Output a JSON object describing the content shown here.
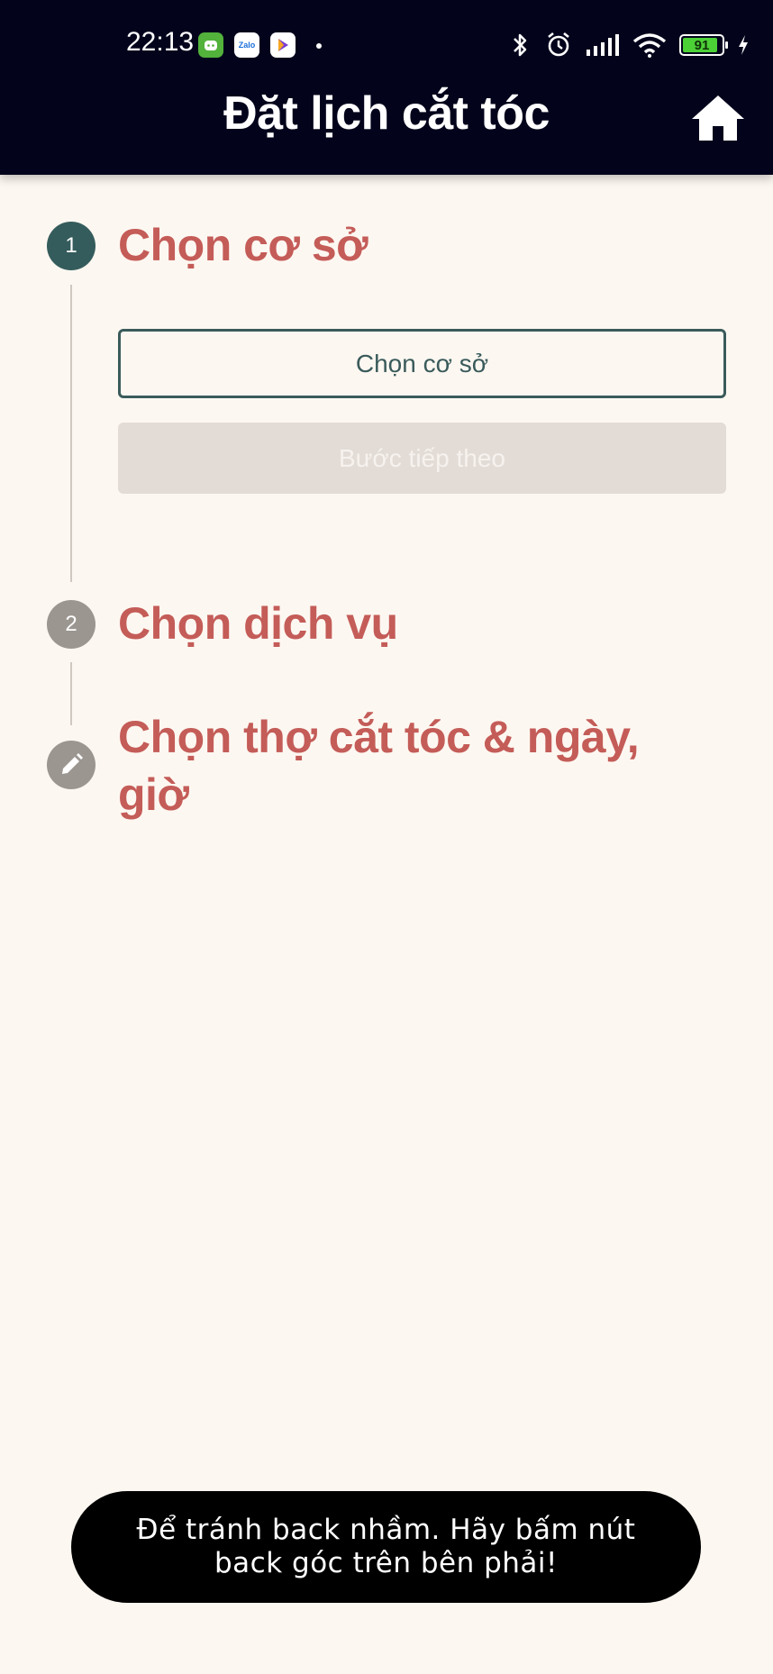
{
  "status_bar": {
    "time": "22:13",
    "notifications": [
      {
        "icon": "messaging-app-icon",
        "label": ""
      },
      {
        "icon": "zalo-icon",
        "label": "Zalo"
      },
      {
        "icon": "play-store-icon",
        "label": ""
      }
    ],
    "battery_level": "91",
    "icons": [
      "bluetooth-icon",
      "alarm-icon",
      "signal-icon",
      "wifi-icon",
      "battery-icon",
      "charging-icon"
    ]
  },
  "header": {
    "title": "Đặt lịch cắt tóc",
    "home_icon": "home-icon"
  },
  "steps": [
    {
      "number": "1",
      "title": "Chọn cơ sở",
      "state": "active"
    },
    {
      "number": "2",
      "title": "Chọn dịch vụ",
      "state": "inactive"
    },
    {
      "number": "",
      "icon": "pencil-icon",
      "title": "Chọn thợ cắt tóc & ngày, giờ",
      "state": "inactive"
    }
  ],
  "step1": {
    "select_label": "Chọn cơ sở",
    "next_label": "Bước tiếp theo"
  },
  "toast": {
    "message": "Để tránh back nhầm. Hãy bấm nút back góc trên bên phải!"
  },
  "colors": {
    "appbar_bg": "#03041c",
    "page_bg": "#fdf7f1",
    "step_title": "#c45c58",
    "step_active": "#355c5c",
    "step_inactive": "#9b9690",
    "next_disabled_bg": "#e3dcd6"
  }
}
